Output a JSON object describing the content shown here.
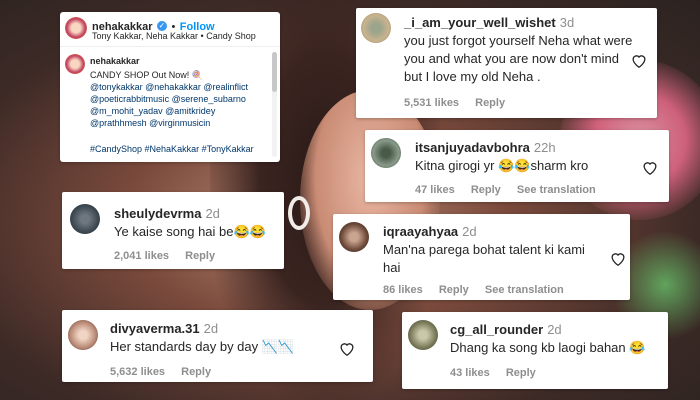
{
  "post": {
    "username": "nehakakkar",
    "follow_label": "Follow",
    "subtitle": "Tony Kakkar, Neha Kakkar • Candy Shop",
    "caption_username": "nehakakkar",
    "caption_line": "CANDY SHOP Out Now! 🍭",
    "mentions": [
      "@tonykakkar @nehakakkar @realinflict",
      "@poeticrabbitmusic @serene_subarno",
      "@m_mohit_yadav @amitkridey",
      "@prathhmesh @virginmusicin"
    ],
    "hashtags": "#CandyShop #NehaKakkar #TonyKakkar"
  },
  "comments": [
    {
      "username": "_i_am_your_well_wishet",
      "time": "3d",
      "text": "you just forgot yourself Neha what were you and what you are now don't mind but I love my old Neha .",
      "likes": "5,531 likes",
      "reply": "Reply",
      "translation": ""
    },
    {
      "username": "itsanjuyadavbohra",
      "time": "22h",
      "text": "Kitna girogi yr 😂😂sharm kro",
      "likes": "47 likes",
      "reply": "Reply",
      "translation": "See translation"
    },
    {
      "username": "sheulydevrma",
      "time": "2d",
      "text": "Ye kaise song hai be😂😂",
      "likes": "2,041 likes",
      "reply": "Reply",
      "translation": ""
    },
    {
      "username": "iqraayahyaa",
      "time": "2d",
      "text": "Man'na parega bohat talent ki kami hai",
      "likes": "86 likes",
      "reply": "Reply",
      "translation": "See translation"
    },
    {
      "username": "divyaverma.31",
      "time": "2d",
      "text": "Her standards day by day 📉📉",
      "likes": "5,632 likes",
      "reply": "Reply",
      "translation": ""
    },
    {
      "username": "cg_all_rounder",
      "time": "2d",
      "text": "Dhang ka song kb laogi bahan 😂",
      "likes": "43 likes",
      "reply": "Reply",
      "translation": ""
    }
  ],
  "colors": {
    "text": "#262626",
    "muted": "#8e8e8e",
    "link": "#0095f6",
    "mention": "#00376b"
  },
  "icons": [
    "heart-icon",
    "verified-badge-icon",
    "avatar"
  ]
}
